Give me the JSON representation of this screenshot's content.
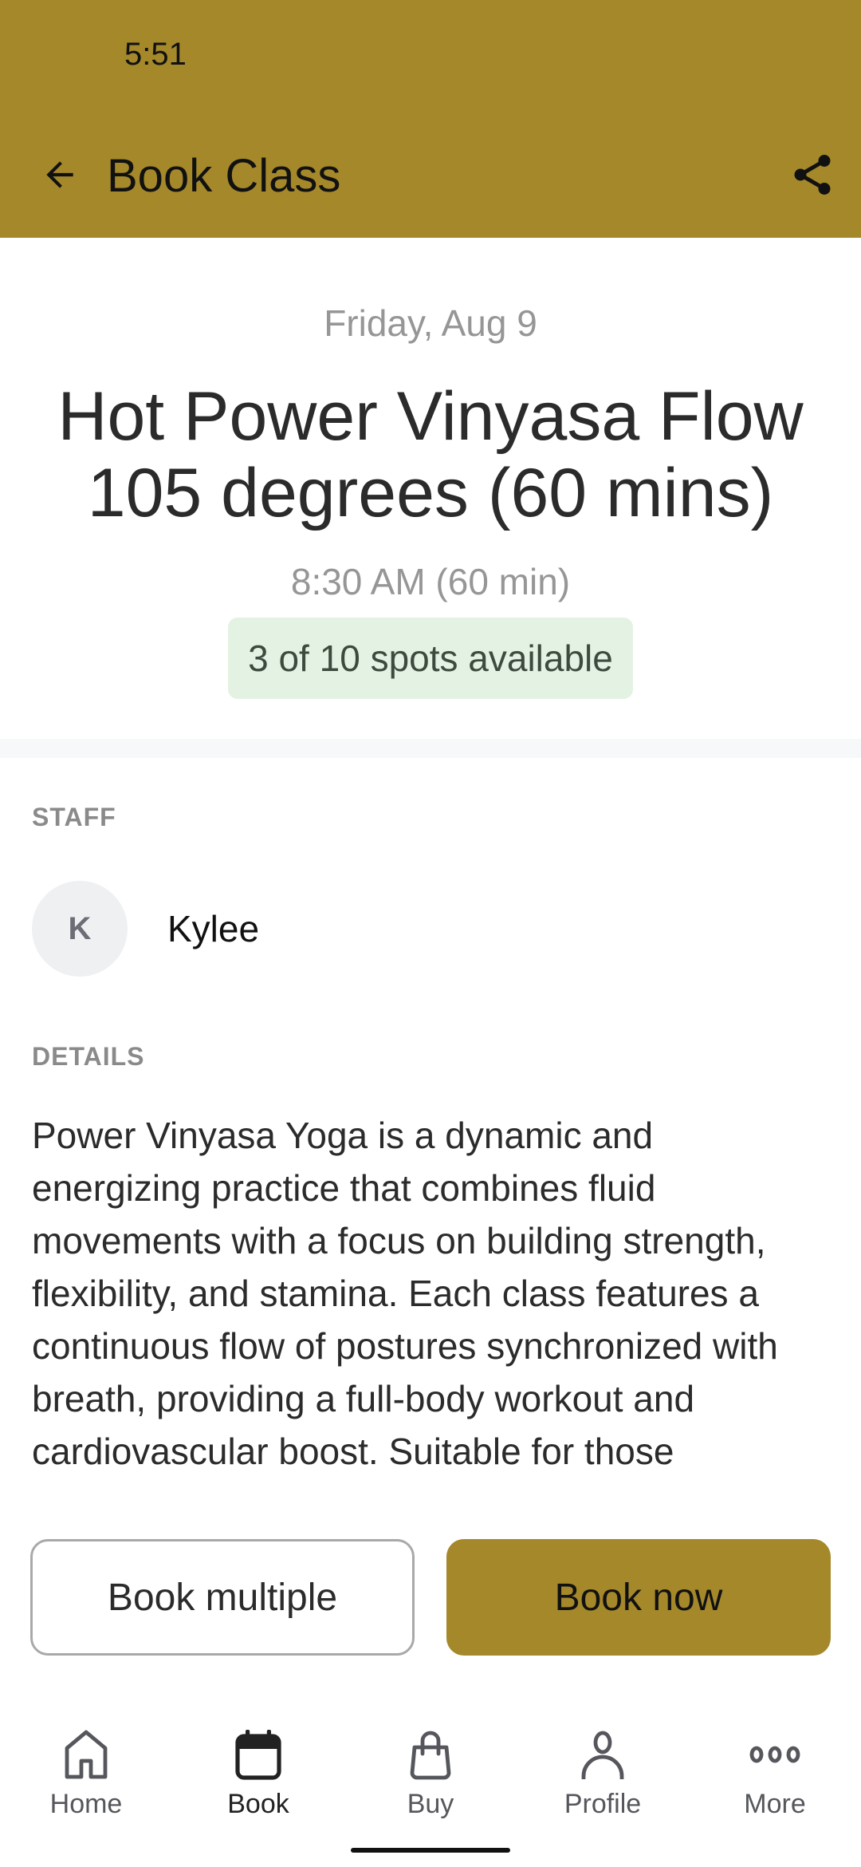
{
  "status_bar": {
    "time": "5:51"
  },
  "app_bar": {
    "title": "Book Class",
    "back_icon": "arrow-left-icon",
    "share_icon": "share-icon",
    "background_color": "#a5882a"
  },
  "class": {
    "date": "Friday, Aug 9",
    "title": "Hot Power Vinyasa Flow 105 degrees (60 mins)",
    "time": "8:30 AM (60 min)",
    "spots_available": "3 of 10 spots available",
    "spots_badge_color": "#e4f2e3"
  },
  "staff": {
    "section_label": "STAFF",
    "members": [
      {
        "initial": "K",
        "name": "Kylee"
      }
    ]
  },
  "details": {
    "section_label": "DETAILS",
    "description": "Power Vinyasa Yoga is a dynamic and energizing practice that combines fluid movements with a focus on building strength, flexibility, and stamina. Each class features a continuous flow of postures synchronized with breath, providing a full-body workout and cardiovascular boost. Suitable for those"
  },
  "actions": {
    "book_multiple_label": "Book multiple",
    "book_now_label": "Book now",
    "accent_color": "#a5882a"
  },
  "bottom_nav": {
    "items": [
      {
        "label": "Home",
        "icon": "home-icon",
        "active": false
      },
      {
        "label": "Book",
        "icon": "calendar-icon",
        "active": true
      },
      {
        "label": "Buy",
        "icon": "shopping-bag-icon",
        "active": false
      },
      {
        "label": "Profile",
        "icon": "person-icon",
        "active": false
      },
      {
        "label": "More",
        "icon": "more-dots-icon",
        "active": false
      }
    ]
  }
}
